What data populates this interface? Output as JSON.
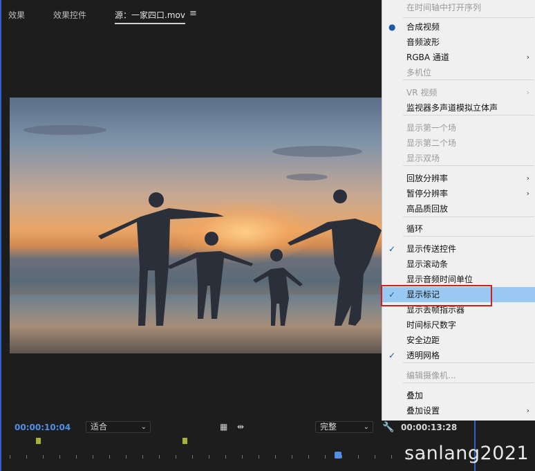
{
  "tabs": [
    {
      "label": "效果"
    },
    {
      "label": "效果控件"
    },
    {
      "label": "源：一家四口.mov"
    }
  ],
  "timecode_current": "00:00:10:04",
  "timecode_duration": "00:00:13:28",
  "fit_dropdown": "适合",
  "quality_dropdown": "完整",
  "watermark": "sanlang2021",
  "menu": [
    {
      "label": "在时间轴中打开序列",
      "disabled": true
    },
    {
      "label": "合成视频",
      "mark": "●"
    },
    {
      "label": "音频波形"
    },
    {
      "label": "RGBA 通道",
      "submenu": true
    },
    {
      "label": "多机位",
      "disabled": true
    },
    {
      "label": "VR 视频",
      "disabled": true,
      "submenu": true
    },
    {
      "label": "监视器多声道模拟立体声"
    },
    {
      "label": "显示第一个场",
      "disabled": true
    },
    {
      "label": "显示第二个场",
      "disabled": true
    },
    {
      "label": "显示双场",
      "disabled": true
    },
    {
      "label": "回放分辨率",
      "submenu": true
    },
    {
      "label": "暂停分辨率",
      "submenu": true
    },
    {
      "label": "高品质回放"
    },
    {
      "label": "循环"
    },
    {
      "label": "显示传送控件",
      "mark": "✓"
    },
    {
      "label": "显示滚动条"
    },
    {
      "label": "显示音频时间单位"
    },
    {
      "label": "显示标记",
      "mark": "✓",
      "highlight": true
    },
    {
      "label": "显示丢帧指示器"
    },
    {
      "label": "时间标尺数字"
    },
    {
      "label": "安全边距"
    },
    {
      "label": "透明网格",
      "mark": "✓"
    },
    {
      "label": "编辑摄像机...",
      "disabled": true
    },
    {
      "label": "叠加"
    },
    {
      "label": "叠加设置",
      "submenu": true
    }
  ],
  "colors": {
    "accent": "#4f8fe6",
    "highlight": "#99c9f2",
    "callout": "#d81a1a"
  }
}
